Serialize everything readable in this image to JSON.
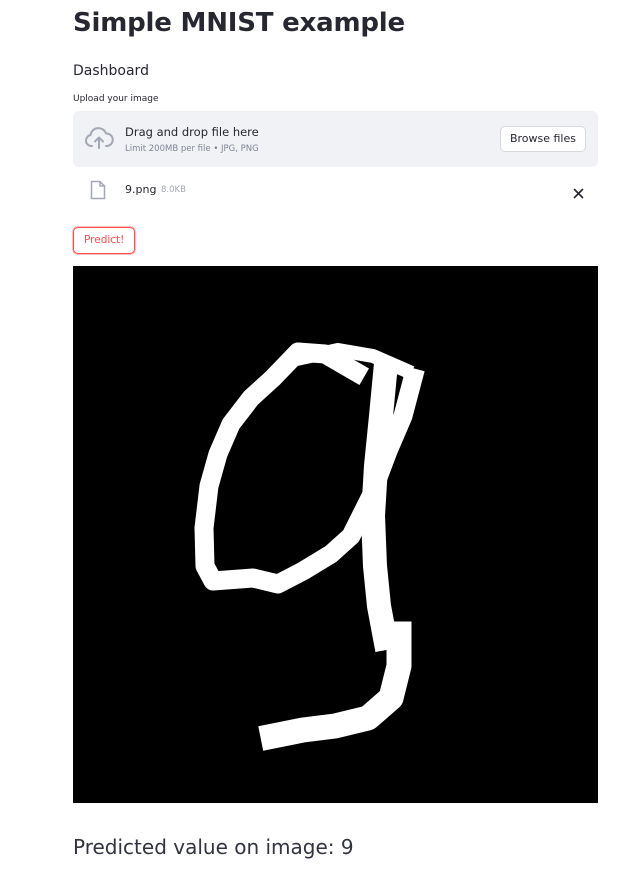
{
  "page": {
    "title": "Simple MNIST example",
    "subtitle": "Dashboard"
  },
  "uploader": {
    "label": "Upload your image",
    "drop_title": "Drag and drop file here",
    "drop_hint": "Limit 200MB per file • JPG, PNG",
    "browse_label": "Browse files",
    "cloud_icon": "cloud-upload-icon"
  },
  "uploaded_file": {
    "name": "9.png",
    "size": "8.0KB",
    "file_icon": "file-icon",
    "remove_icon": "close-icon"
  },
  "actions": {
    "predict_label": "Predict!"
  },
  "result": {
    "text": "Predicted value on image: 9"
  },
  "colors": {
    "primary": "#ff4b4b",
    "text": "#262730",
    "dropzone_bg": "#f0f2f6"
  }
}
